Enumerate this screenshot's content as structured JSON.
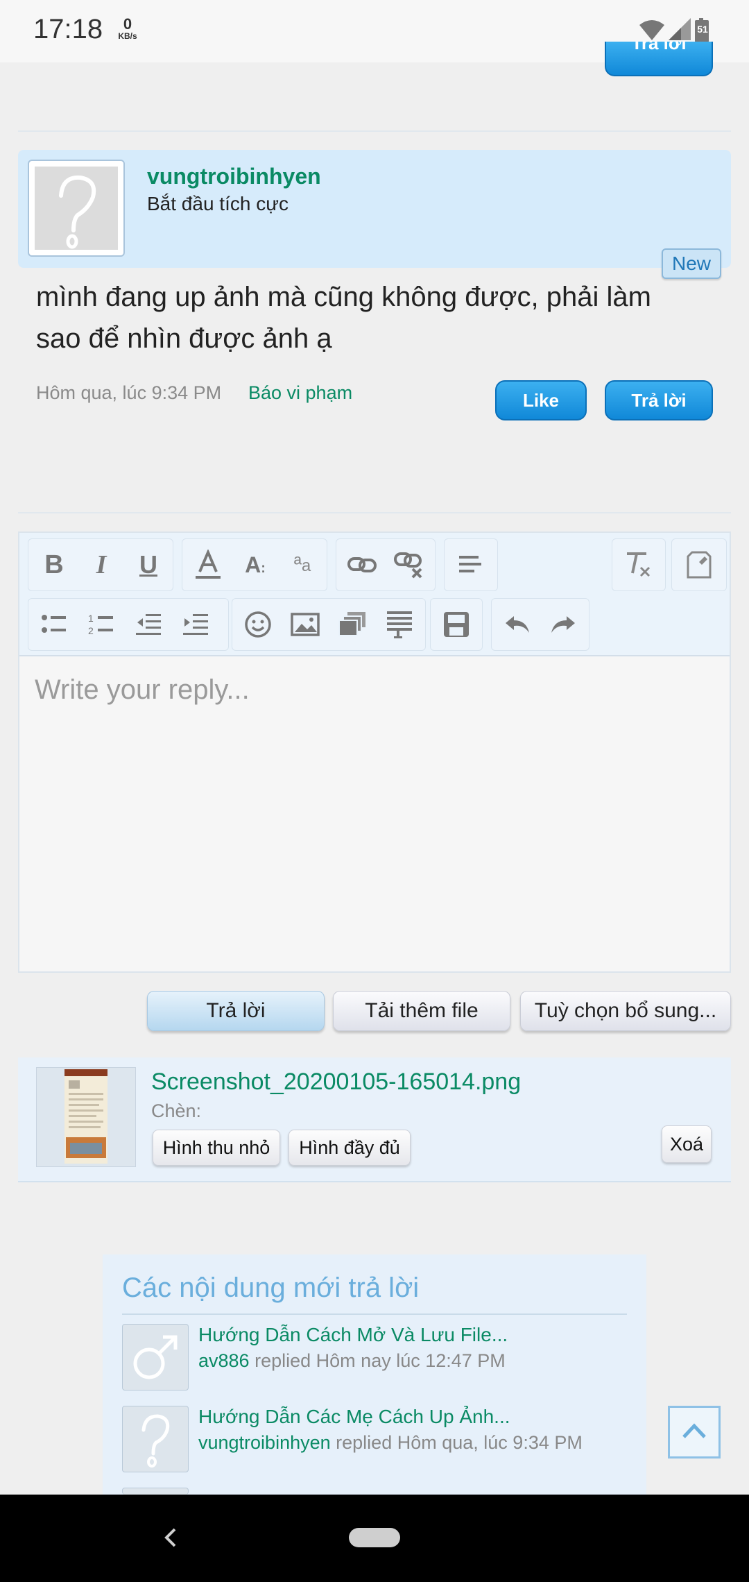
{
  "status_bar": {
    "time": "17:18",
    "net_speed": "0",
    "net_unit": "KB/s",
    "battery": "51"
  },
  "post": {
    "username": "vungtroibinhyen",
    "user_title": "Bắt đầu tích cực",
    "new_badge": "New",
    "message": "mình đang up ảnh mà cũng không được, phải làm sao để nhìn được ảnh ạ",
    "date": "Hôm qua, lúc 9:34 PM",
    "report_label": "Báo vi phạm",
    "like_label": "Like",
    "reply_label": "Trả lời"
  },
  "top_button_label": "Trả lời",
  "editor": {
    "placeholder": "Write your reply...",
    "toolbar_icons": [
      "bold-icon",
      "italic-icon",
      "underline-icon",
      "font-color-icon",
      "font-size-icon",
      "font-family-icon",
      "link-icon",
      "unlink-icon",
      "align-icon",
      "remove-format-icon",
      "toggle-source-icon",
      "bullet-list-icon",
      "numbered-list-icon",
      "outdent-icon",
      "indent-icon",
      "smiley-icon",
      "image-icon",
      "media-icon",
      "quote-icon",
      "save-draft-icon",
      "undo-icon",
      "redo-icon"
    ]
  },
  "actions": {
    "reply": "Trả lời",
    "upload": "Tải thêm file",
    "more_options": "Tuỳ chọn bổ sung..."
  },
  "attachment": {
    "filename": "Screenshot_20200105-165014.png",
    "insert_label": "Chèn:",
    "thumbnail": "Hình thu nhỏ",
    "full_image": "Hình đầy đủ",
    "delete": "Xoá"
  },
  "recent": {
    "title": "Các nội dung mới trả lời",
    "items": [
      {
        "title": "Hướng Dẫn Cách Mở Và Lưu File...",
        "user": "av886",
        "replied": "replied",
        "time": "Hôm nay lúc 12:47 PM"
      },
      {
        "title": "Hướng Dẫn Các Mẹ Cách Up Ảnh...",
        "user": "vungtroibinhyen",
        "replied": "replied",
        "time": "Hôm qua, lúc 9:34 PM"
      }
    ]
  },
  "colors": {
    "accent_green": "#0a8a64",
    "button_blue": "#1088d8",
    "heading_blue": "#6aaedc"
  }
}
